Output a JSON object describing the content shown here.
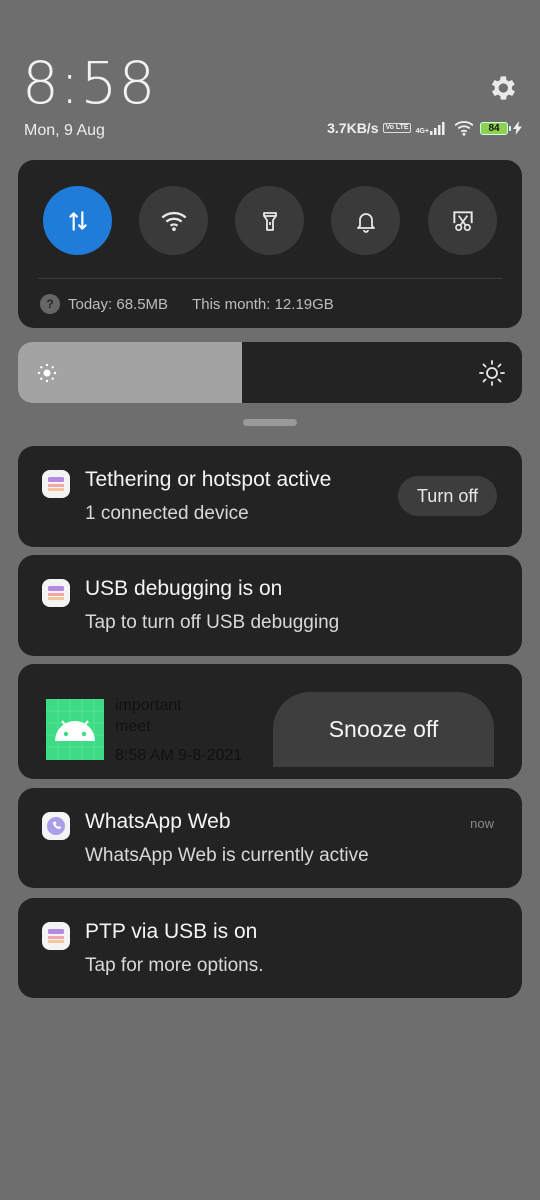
{
  "statusbar": {
    "time": "8:58",
    "date": "Mon, 9 Aug",
    "net_speed": "3.7KB/s",
    "volte": "Vo LTE",
    "net_type": "4G+",
    "battery": "84",
    "icons": [
      "volte-icon",
      "cell-signal-icon",
      "wifi-icon",
      "battery-icon",
      "charging-icon",
      "settings-gear-icon"
    ]
  },
  "quick_settings": {
    "tiles": [
      {
        "name": "mobile-data",
        "icon": "data-transfer-icon",
        "active": true
      },
      {
        "name": "wifi",
        "icon": "wifi-icon",
        "active": false
      },
      {
        "name": "flashlight",
        "icon": "flashlight-icon",
        "active": false
      },
      {
        "name": "sound",
        "icon": "bell-icon",
        "active": false
      },
      {
        "name": "screenshot",
        "icon": "scissors-screen-icon",
        "active": false
      }
    ],
    "usage_today": "Today: 68.5MB",
    "usage_month": "This month: 12.19GB"
  },
  "brightness": {
    "level": 0.445
  },
  "notifications": {
    "tethering": {
      "title": "Tethering or hotspot active",
      "body": "1 connected device",
      "action": "Turn off"
    },
    "usb_debug": {
      "title": "USB debugging is on",
      "body": "Tap to turn off USB debugging"
    },
    "alarm": {
      "line1": "important",
      "line2": "meet",
      "line3": "8:58 AM 9-8-2021",
      "action": "Snooze off"
    },
    "whatsapp": {
      "title": "WhatsApp Web",
      "body": "WhatsApp Web is currently active",
      "time": "now"
    },
    "ptp": {
      "title": "PTP via USB is on",
      "body": "Tap for more options."
    }
  },
  "colors": {
    "accent": "#1f7cd8",
    "panel": "#232323",
    "background": "#6e6e6e",
    "android_green": "#3ddc84"
  }
}
